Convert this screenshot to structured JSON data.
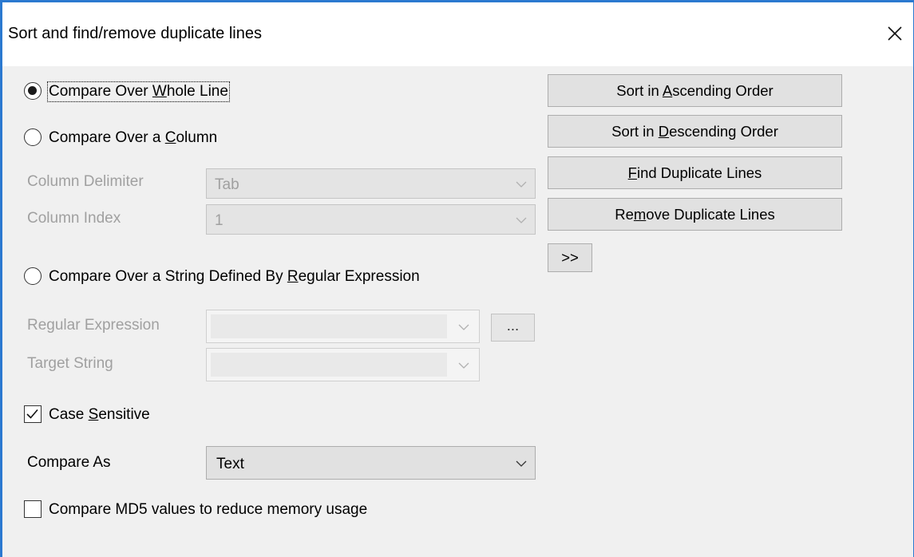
{
  "window": {
    "title": "Sort and find/remove duplicate lines"
  },
  "options": {
    "whole_line": {
      "pre": "Compare Over ",
      "mn": "W",
      "post": "hole Line",
      "checked": true
    },
    "column": {
      "pre": "Compare Over a ",
      "mn": "C",
      "post": "olumn",
      "checked": false
    },
    "regex": {
      "pre": "Compare Over a String Defined By ",
      "mn": "R",
      "post": "egular Expression",
      "checked": false
    }
  },
  "column_settings": {
    "delimiter_label": "Column Delimiter",
    "delimiter_value": "Tab",
    "index_label": "Column Index",
    "index_value": "1"
  },
  "regex_settings": {
    "regex_label": "Regular Expression",
    "regex_value": "",
    "browse_label": "...",
    "target_label": "Target String",
    "target_value": ""
  },
  "case_sensitive": {
    "pre": "Case ",
    "mn": "S",
    "post": "ensitive",
    "checked": true
  },
  "compare_as": {
    "label": "Compare As",
    "value": "Text"
  },
  "md5": {
    "label": "Compare MD5 values to reduce memory usage",
    "checked": false
  },
  "buttons": {
    "asc": {
      "pre": "Sort in ",
      "mn": "A",
      "post": "scending Order"
    },
    "desc": {
      "pre": "Sort in ",
      "mn": "D",
      "post": "escending Order"
    },
    "find": {
      "pre": "",
      "mn": "F",
      "post": "ind Duplicate Lines"
    },
    "remove": {
      "pre": "Re",
      "mn": "m",
      "post": "ove Duplicate Lines"
    },
    "more": ">>"
  },
  "icons": {
    "close": "close-icon",
    "chevron": "chevron-down-icon"
  }
}
